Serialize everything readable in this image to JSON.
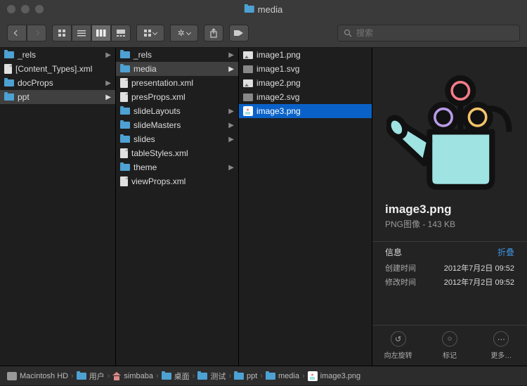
{
  "window": {
    "title": "media"
  },
  "toolbar": {
    "search_placeholder": "搜索"
  },
  "col1": [
    {
      "name": "_rels",
      "type": "folder",
      "hasChildren": true
    },
    {
      "name": "[Content_Types].xml",
      "type": "file"
    },
    {
      "name": "docProps",
      "type": "folder",
      "hasChildren": true
    },
    {
      "name": "ppt",
      "type": "folder",
      "hasChildren": true,
      "selected": true
    }
  ],
  "col2": [
    {
      "name": "_rels",
      "type": "folder",
      "hasChildren": true
    },
    {
      "name": "media",
      "type": "folder",
      "hasChildren": true,
      "selected": true
    },
    {
      "name": "presentation.xml",
      "type": "file"
    },
    {
      "name": "presProps.xml",
      "type": "file"
    },
    {
      "name": "slideLayouts",
      "type": "folder",
      "hasChildren": true
    },
    {
      "name": "slideMasters",
      "type": "folder",
      "hasChildren": true
    },
    {
      "name": "slides",
      "type": "folder",
      "hasChildren": true
    },
    {
      "name": "tableStyles.xml",
      "type": "file"
    },
    {
      "name": "theme",
      "type": "folder",
      "hasChildren": true
    },
    {
      "name": "viewProps.xml",
      "type": "file"
    }
  ],
  "col3": [
    {
      "name": "image1.png",
      "type": "png"
    },
    {
      "name": "image1.svg",
      "type": "svg"
    },
    {
      "name": "image2.png",
      "type": "png"
    },
    {
      "name": "image2.svg",
      "type": "svg"
    },
    {
      "name": "image3.png",
      "type": "png3",
      "selected": true
    }
  ],
  "preview": {
    "filename": "image3.png",
    "subtitle": "PNG图像 - 143 KB",
    "info_label": "信息",
    "collapse_label": "折叠",
    "rows": [
      {
        "label": "创建时间",
        "value": "2012年7月2日 09:52"
      },
      {
        "label": "修改时间",
        "value": "2012年7月2日 09:52"
      }
    ],
    "actions": [
      {
        "name": "rotate-left",
        "label": "向左旋转",
        "glyph": "↺"
      },
      {
        "name": "tag",
        "label": "标记",
        "glyph": "○"
      },
      {
        "name": "more",
        "label": "更多…",
        "glyph": "⋯"
      }
    ]
  },
  "path": [
    {
      "name": "Macintosh HD",
      "icon": "hd"
    },
    {
      "name": "用户",
      "icon": "folder"
    },
    {
      "name": "simbaba",
      "icon": "home"
    },
    {
      "name": "桌面",
      "icon": "folder"
    },
    {
      "name": "测试",
      "icon": "folder"
    },
    {
      "name": "ppt",
      "icon": "folder"
    },
    {
      "name": "media",
      "icon": "folder"
    },
    {
      "name": "image3.png",
      "icon": "png3"
    }
  ]
}
